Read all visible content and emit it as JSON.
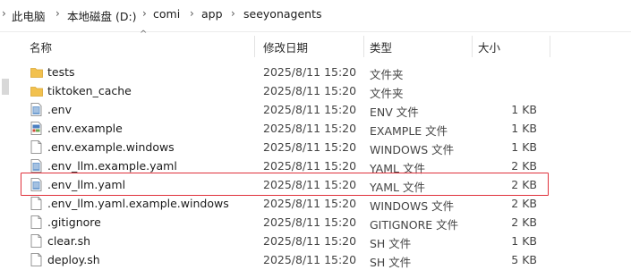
{
  "breadcrumb": {
    "segments": [
      "此电脑",
      "本地磁盘 (D:)",
      "comi",
      "app",
      "seeyonagents"
    ]
  },
  "columns": {
    "name": "名称",
    "date": "修改日期",
    "type": "类型",
    "size": "大小"
  },
  "files": [
    {
      "name": "tests",
      "date": "2025/8/11 15:20",
      "type": "文件夹",
      "size": "",
      "icon": "folder-icon"
    },
    {
      "name": "tiktoken_cache",
      "date": "2025/8/11 15:20",
      "type": "文件夹",
      "size": "",
      "icon": "folder-icon"
    },
    {
      "name": ".env",
      "date": "2025/8/11 15:20",
      "type": "ENV 文件",
      "size": "1 KB",
      "icon": "text-file-icon"
    },
    {
      "name": ".env.example",
      "date": "2025/8/11 15:20",
      "type": "EXAMPLE 文件",
      "size": "1 KB",
      "icon": "example-file-icon"
    },
    {
      "name": ".env.example.windows",
      "date": "2025/8/11 15:20",
      "type": "WINDOWS 文件",
      "size": "1 KB",
      "icon": "blank-file-icon"
    },
    {
      "name": ".env_llm.example.yaml",
      "date": "2025/8/11 15:20",
      "type": "YAML 文件",
      "size": "2 KB",
      "icon": "text-file-icon"
    },
    {
      "name": ".env_llm.yaml",
      "date": "2025/8/11 15:20",
      "type": "YAML 文件",
      "size": "2 KB",
      "icon": "text-file-icon"
    },
    {
      "name": ".env_llm.yaml.example.windows",
      "date": "2025/8/11 15:20",
      "type": "WINDOWS 文件",
      "size": "2 KB",
      "icon": "blank-file-icon"
    },
    {
      "name": ".gitignore",
      "date": "2025/8/11 15:20",
      "type": "GITIGNORE 文件",
      "size": "2 KB",
      "icon": "blank-file-icon"
    },
    {
      "name": "clear.sh",
      "date": "2025/8/11 15:20",
      "type": "SH 文件",
      "size": "1 KB",
      "icon": "blank-file-icon"
    },
    {
      "name": "deploy.sh",
      "date": "2025/8/11 15:20",
      "type": "SH 文件",
      "size": "5 KB",
      "icon": "blank-file-icon"
    }
  ],
  "highlighted_file": ".env_llm.yaml",
  "colors": {
    "highlight_border": "#e0323c",
    "folder": "#f2c14e",
    "text_file": "#5a8fc9"
  }
}
